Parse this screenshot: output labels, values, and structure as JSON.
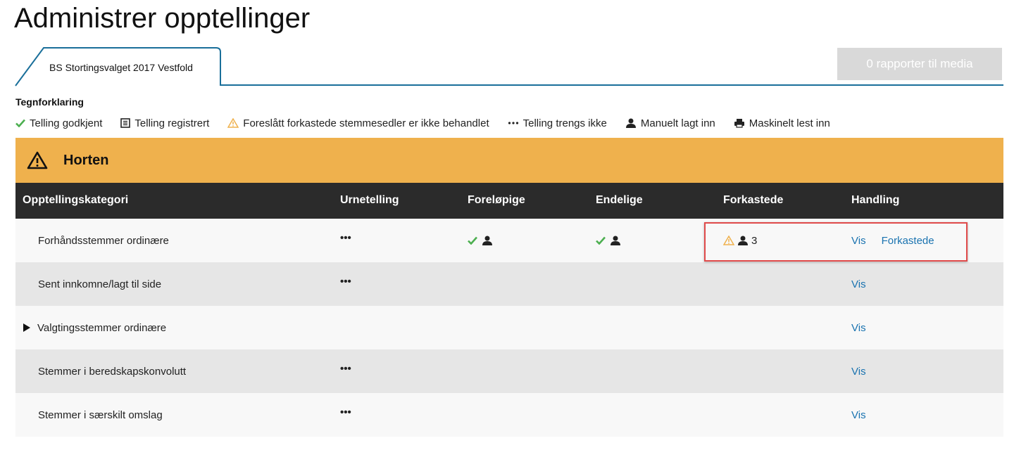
{
  "page": {
    "title": "Administrer opptellinger"
  },
  "tabs": [
    {
      "label": "BS Stortingsvalget 2017 Vestfold",
      "active": true
    }
  ],
  "media_button": {
    "label": "0 rapporter til media",
    "disabled": true
  },
  "legend": {
    "title": "Tegnforklaring",
    "items": [
      {
        "icon": "check-icon",
        "label": "Telling godkjent"
      },
      {
        "icon": "document-icon",
        "label": "Telling registrert"
      },
      {
        "icon": "warning-icon",
        "label": "Foreslått forkastede stemmesedler er ikke behandlet"
      },
      {
        "icon": "ellipsis-icon",
        "label": "Telling trengs ikke"
      },
      {
        "icon": "person-icon",
        "label": "Manuelt lagt inn"
      },
      {
        "icon": "printer-icon",
        "label": "Maskinelt lest inn"
      }
    ]
  },
  "section": {
    "title": "Horten",
    "header_color": "#efb14d",
    "columns": [
      "Opptellingskategori",
      "Urnetelling",
      "Foreløpige",
      "Endelige",
      "Forkastede",
      "Handling"
    ],
    "rows": [
      {
        "category": "Forhåndsstemmer ordinære",
        "urnetelling": "•••",
        "forelopige": "check+person",
        "endelige": "check+person",
        "forkastede": {
          "icons": "warning+person",
          "count": "3"
        },
        "actions": [
          "Vis",
          "Forkastede"
        ]
      },
      {
        "category": "Sent innkomne/lagt til side",
        "urnetelling": "•••",
        "actions": [
          "Vis"
        ]
      },
      {
        "category": "Valgtingsstemmer ordinære",
        "expandable": true,
        "actions": [
          "Vis"
        ]
      },
      {
        "category": "Stemmer i beredskapskonvolutt",
        "urnetelling": "•••",
        "actions": [
          "Vis"
        ]
      },
      {
        "category": "Stemmer i særskilt omslag",
        "urnetelling": "•••",
        "actions": [
          "Vis"
        ]
      }
    ]
  },
  "colors": {
    "link": "#1a73b0",
    "check": "#4caf50",
    "warning": "#efb14d",
    "header_dark": "#2b2b2b",
    "tab_border": "#1a6f9a",
    "highlight": "#e04a4a"
  }
}
